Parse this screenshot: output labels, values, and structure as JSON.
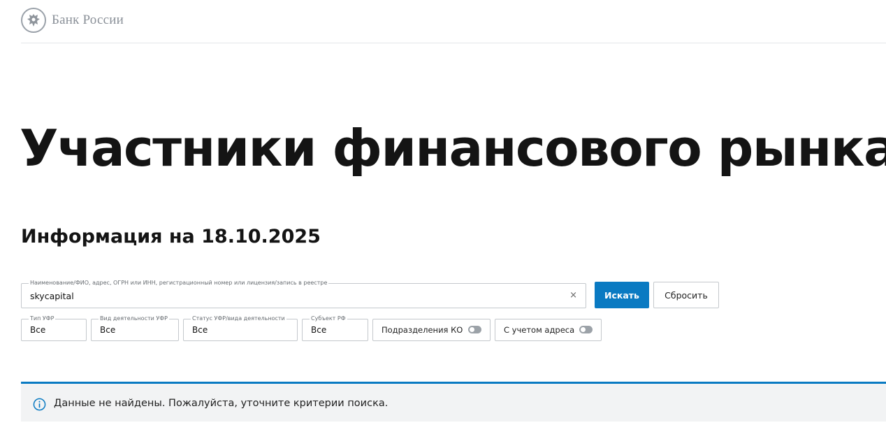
{
  "header": {
    "logo_text": "Банк России"
  },
  "page": {
    "title": "Участники финансового рынка",
    "info_date": "Информация на 18.10.2025"
  },
  "search": {
    "label": "Наименование/ФИО, адрес, ОГРН или ИНН, регистрационный номер или лицензия/запись в реестре",
    "value": "skycapital",
    "clear_symbol": "×",
    "submit_label": "Искать",
    "reset_label": "Сбросить"
  },
  "filters": [
    {
      "label": "Тип УФР",
      "value": "Все"
    },
    {
      "label": "Вид деятельности УФР",
      "value": "Все"
    },
    {
      "label": "Статус УФР/вида деятельности",
      "value": "Все"
    },
    {
      "label": "Субъект РФ",
      "value": "Все"
    }
  ],
  "toggles": [
    {
      "label": "Подразделения КО",
      "state": "off"
    },
    {
      "label": "С учетом адреса",
      "state": "off"
    }
  ],
  "notice": {
    "text": "Данные не найдены. Пожалуйста, уточните критерии поиска.",
    "icon": "info-icon"
  },
  "colors": {
    "accent": "#0a7ac2",
    "notice_bg": "#f2f3f4",
    "border": "#c4c8cc"
  }
}
